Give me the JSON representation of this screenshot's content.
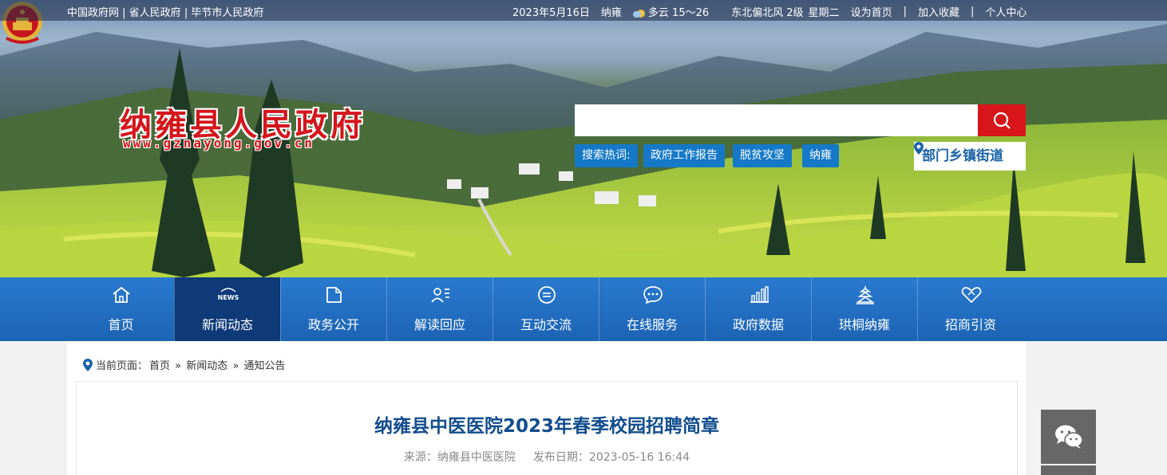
{
  "topbar": {
    "links": [
      "中国政府网",
      "省人民政府",
      "毕节市人民政府"
    ],
    "date": "2023年5月16日",
    "city": "纳雍",
    "weather": "多云 15～26",
    "wind": "东北偏北风 2级",
    "weekday": "星期二",
    "set_home": "设为首页",
    "add_fav": "加入收藏",
    "user_center": "个人中心"
  },
  "header": {
    "site_title": "纳雍县人民政府",
    "site_url": "www.gznayong.gov.cn"
  },
  "search": {
    "placeholder": "",
    "hot_label": "搜索热词:",
    "hot_words": [
      "政府工作报告",
      "脱贫攻坚",
      "纳雍"
    ],
    "dept_link": "部门乡镇街道"
  },
  "nav": {
    "items": [
      {
        "label": "首页",
        "icon": "home-icon"
      },
      {
        "label": "新闻动态",
        "icon": "news-icon",
        "active": true
      },
      {
        "label": "政务公开",
        "icon": "folder-icon"
      },
      {
        "label": "解读回应",
        "icon": "people-icon"
      },
      {
        "label": "互动交流",
        "icon": "chat-icon"
      },
      {
        "label": "在线服务",
        "icon": "message-icon"
      },
      {
        "label": "政府数据",
        "icon": "bar-chart-icon"
      },
      {
        "label": "珙桐纳雍",
        "icon": "tower-icon"
      },
      {
        "label": "招商引资",
        "icon": "handshake-icon"
      }
    ]
  },
  "breadcrumb": {
    "prefix": "当前页面：",
    "items": [
      "首页",
      "新闻动态",
      "通知公告"
    ],
    "separator": "»"
  },
  "article": {
    "title": "纳雍县中医医院2023年春季校园招聘简章",
    "source_label": "来源：",
    "source": "纳雍县中医医院",
    "date_label": "发布日期：",
    "date": "2023-05-16 16:44"
  },
  "colors": {
    "brand_red": "#d8151b",
    "nav_blue": "#1c64b4",
    "nav_active": "#0e3a78",
    "title_blue": "#124d8e"
  }
}
